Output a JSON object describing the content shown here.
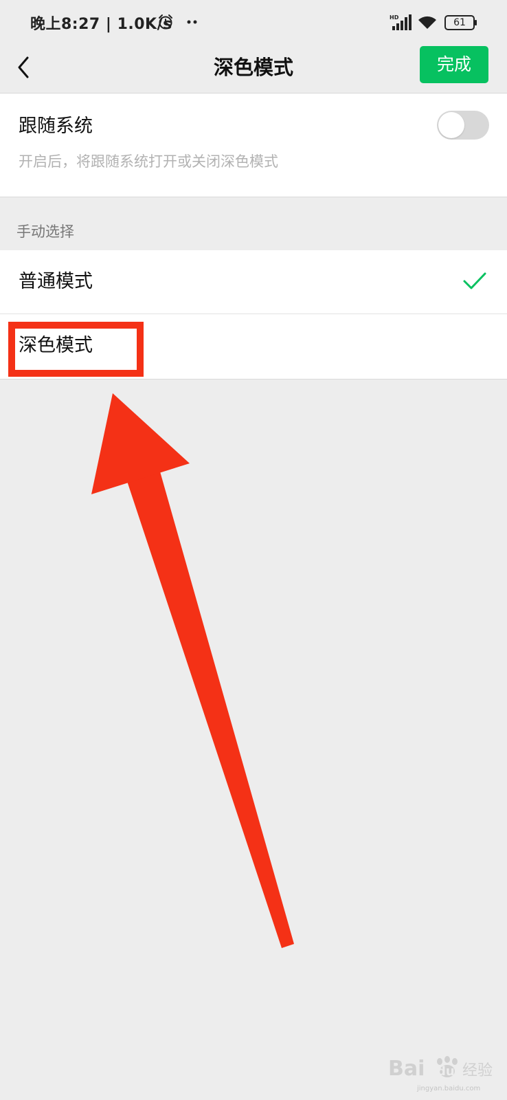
{
  "status_bar": {
    "time": "晚上8:27 | 1.0K/s",
    "battery": "61",
    "icons": [
      "alarm-icon",
      "dots-icon",
      "hd-signal-icon",
      "wifi-icon",
      "battery-icon"
    ]
  },
  "header": {
    "title": "深色模式",
    "done_label": "完成",
    "back_icon": "back-chevron-icon"
  },
  "follow_system": {
    "title": "跟随系统",
    "description": "开启后，将跟随系统打开或关闭深色模式",
    "enabled": false
  },
  "manual": {
    "label": "手动选择",
    "options": [
      {
        "label": "普通模式",
        "selected": true
      },
      {
        "label": "深色模式",
        "selected": false
      }
    ]
  },
  "watermark": {
    "brand": "Bai du 经验",
    "url": "jingyan.baidu.com"
  },
  "colors": {
    "accent_green": "#07c160",
    "annotation_red": "#f43116",
    "background": "#ededed"
  }
}
